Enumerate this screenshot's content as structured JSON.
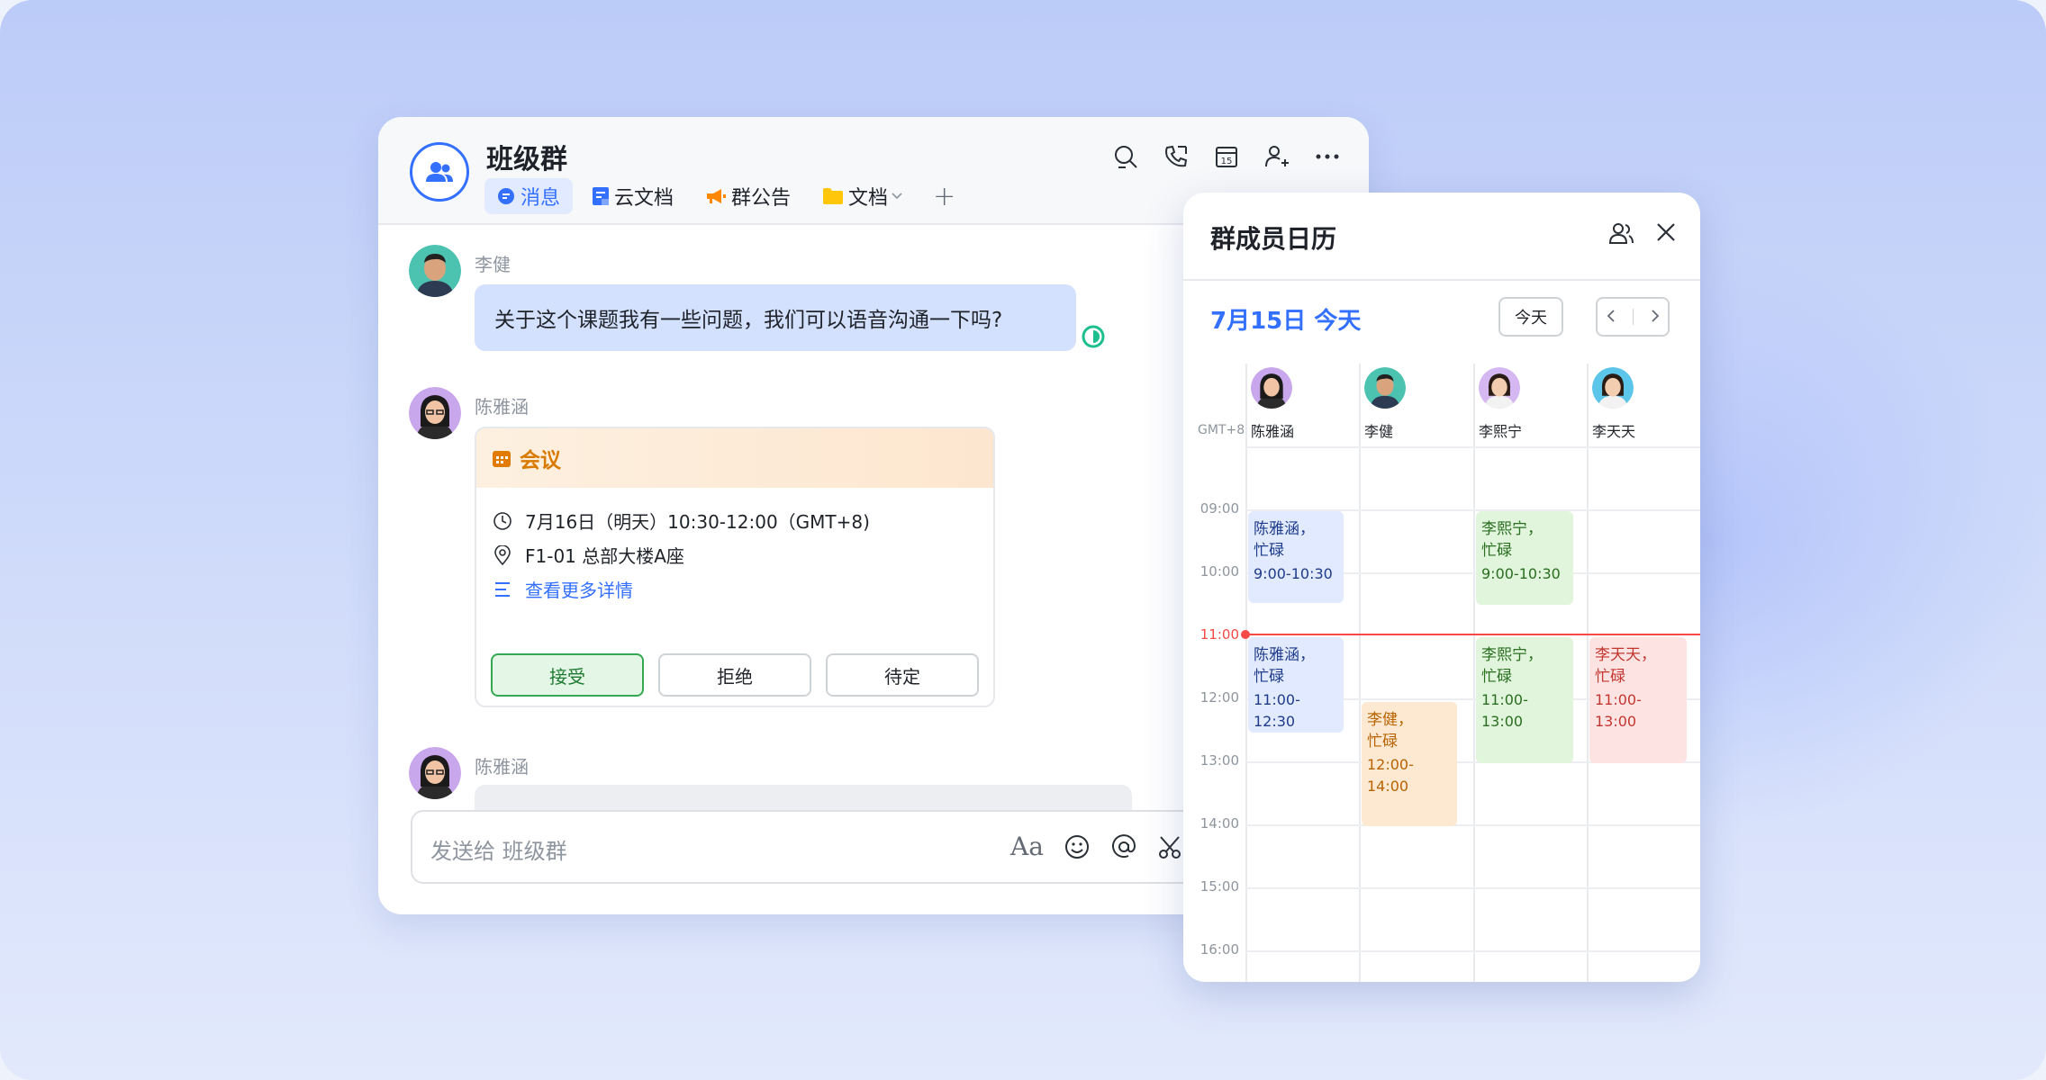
{
  "chat": {
    "title": "班级群",
    "tabs": [
      {
        "label": "消息",
        "icon": "message-icon"
      },
      {
        "label": "云文档",
        "icon": "doc-icon"
      },
      {
        "label": "群公告",
        "icon": "announcement-icon"
      },
      {
        "label": "文档",
        "icon": "folder-icon"
      }
    ],
    "add_tab": "+",
    "header_icons": [
      "search-icon",
      "phone-call-icon",
      "calendar-icon",
      "add-member-icon",
      "more-icon"
    ],
    "messages": [
      {
        "sender": "李健",
        "text": "关于这个课题我有一些问题，我们可以语音沟通一下吗?"
      },
      {
        "sender": "陈雅涵",
        "card": {
          "title": "会议",
          "time": "7月16日（明天）10:30-12:00（GMT+8)",
          "location": "F1-01 总部大楼A座",
          "details_link": "查看更多详情",
          "buttons": {
            "accept": "接受",
            "decline": "拒绝",
            "tentative": "待定"
          }
        }
      },
      {
        "sender": "陈雅涵"
      }
    ],
    "input": {
      "placeholder": "发送给 班级群",
      "format_label": "Aa"
    }
  },
  "calendar": {
    "title": "群成员日历",
    "date_label": "7月15日 今天",
    "today_button": "今天",
    "timezone": "GMT+8",
    "hours": [
      "09:00",
      "10:00",
      "11:00",
      "12:00",
      "13:00",
      "14:00",
      "15:00",
      "16:00"
    ],
    "current_hour": "11:00",
    "members": [
      "陈雅涵",
      "李健",
      "李熙宁",
      "李天天"
    ],
    "events": [
      {
        "member": 0,
        "name": "陈雅涵，",
        "status": "忙碌",
        "time": "9:00-10:30",
        "color": "blue"
      },
      {
        "member": 0,
        "name": "陈雅涵，",
        "status": "忙碌",
        "time": "11:00-12:30",
        "color": "blue"
      },
      {
        "member": 1,
        "name": "李健，",
        "status": "忙碌",
        "time": "12:00-14:00",
        "color": "orange"
      },
      {
        "member": 2,
        "name": "李熙宁，",
        "status": "忙碌",
        "time": "9:00-10:30",
        "color": "green"
      },
      {
        "member": 2,
        "name": "李熙宁，",
        "status": "忙碌",
        "time": "11:00-13:00",
        "color": "green"
      },
      {
        "member": 3,
        "name": "李天天，",
        "status": "忙碌",
        "time": "11:00-13:00",
        "color": "red"
      }
    ]
  },
  "colors": {
    "accent": "#3370ff",
    "meeting": "#d97a00",
    "now_line": "#f54a45"
  }
}
